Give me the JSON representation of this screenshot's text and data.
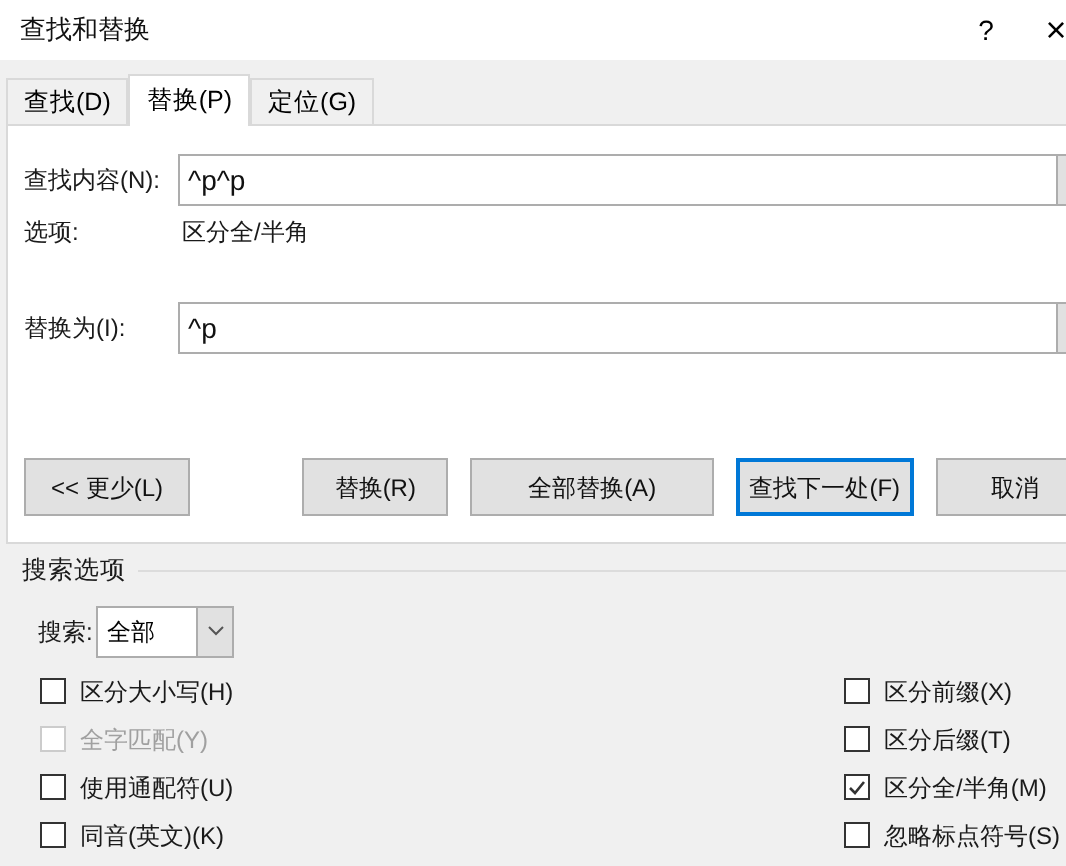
{
  "window": {
    "title": "查找和替换",
    "help": "?",
    "close": "×"
  },
  "tabs": [
    {
      "label": "查找(D)",
      "selected": false
    },
    {
      "label": "替换(P)",
      "selected": true
    },
    {
      "label": "定位(G)",
      "selected": false
    }
  ],
  "find": {
    "label": "查找内容(N):",
    "value": "^p^p"
  },
  "options": {
    "label": "选项:",
    "value": "区分全/半角"
  },
  "replace": {
    "label": "替换为(I):",
    "value": "^p"
  },
  "buttons": [
    {
      "label": "<< 更少(L)",
      "default": false
    },
    {
      "label": "替换(R)",
      "default": false
    },
    {
      "label": "全部替换(A)",
      "default": false
    },
    {
      "label": "查找下一处(F)",
      "default": true
    },
    {
      "label": "取消",
      "default": false
    }
  ],
  "search_options": {
    "title": "搜索选项",
    "search_label": "搜索:",
    "search_value": "全部"
  },
  "left_checks": [
    {
      "label": "区分大小写(H)",
      "checked": false,
      "disabled": false
    },
    {
      "label": "全字匹配(Y)",
      "checked": false,
      "disabled": true
    },
    {
      "label": "使用通配符(U)",
      "checked": false,
      "disabled": false
    },
    {
      "label": "同音(英文)(K)",
      "checked": false,
      "disabled": false
    }
  ],
  "right_checks": [
    {
      "label": "区分前缀(X)",
      "checked": false,
      "disabled": false
    },
    {
      "label": "区分后缀(T)",
      "checked": false,
      "disabled": false
    },
    {
      "label": "区分全/半角(M)",
      "checked": true,
      "disabled": false
    },
    {
      "label": "忽略标点符号(S)",
      "checked": false,
      "disabled": false
    }
  ]
}
